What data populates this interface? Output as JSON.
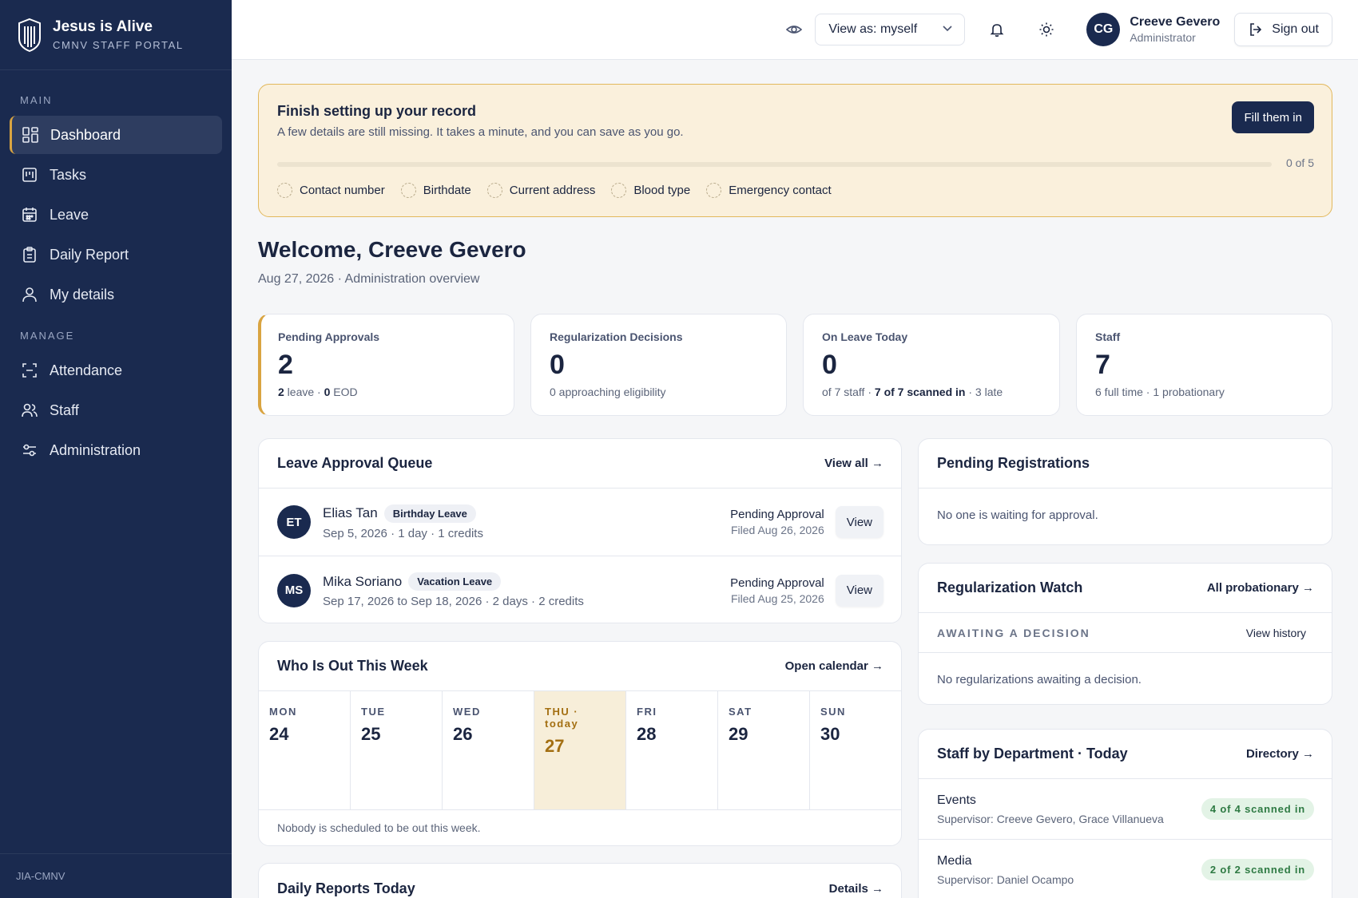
{
  "brand": {
    "title": "Jesus is Alive",
    "subtitle": "CMNV STAFF PORTAL"
  },
  "sidebar": {
    "main_label": "MAIN",
    "manage_label": "MANAGE",
    "main_items": [
      {
        "label": "Dashboard",
        "icon": "dashboard-icon"
      },
      {
        "label": "Tasks",
        "icon": "tasks-icon"
      },
      {
        "label": "Leave",
        "icon": "calendar-icon"
      },
      {
        "label": "Daily Report",
        "icon": "clipboard-icon"
      },
      {
        "label": "My details",
        "icon": "user-icon"
      }
    ],
    "manage_items": [
      {
        "label": "Attendance",
        "icon": "scan-icon"
      },
      {
        "label": "Staff",
        "icon": "users-icon"
      },
      {
        "label": "Administration",
        "icon": "sliders-icon"
      }
    ],
    "footer": "JIA-CMNV"
  },
  "header": {
    "view_as": "View as: myself",
    "user_initials": "CG",
    "user_name": "Creeve Gevero",
    "user_role": "Administrator",
    "sign_out": "Sign out"
  },
  "setup": {
    "title": "Finish setting up your record",
    "description": "A few details are still missing. It takes a minute, and you can save as you go.",
    "button": "Fill them in",
    "progress_text": "0 of 5",
    "progress_fraction": 0,
    "items": [
      "Contact number",
      "Birthdate",
      "Current address",
      "Blood type",
      "Emergency contact"
    ]
  },
  "welcome": {
    "title": "Welcome, Creeve Gevero",
    "subtitle": "Aug 27, 2026 · Administration overview"
  },
  "stats": {
    "pending": {
      "label": "Pending Approvals",
      "value": "2",
      "n1": "2",
      "t1": " leave · ",
      "n2": "0",
      "t2": " EOD"
    },
    "regularization": {
      "label": "Regularization Decisions",
      "value": "0",
      "sub": "0 approaching eligibility"
    },
    "on_leave": {
      "label": "On Leave Today",
      "value": "0",
      "t1": "of 7 staff · ",
      "bold": "7 of 7 scanned in",
      "t2": " · 3 late"
    },
    "staff": {
      "label": "Staff",
      "value": "7",
      "sub": "6 full time · 1 probationary"
    }
  },
  "leave_queue": {
    "title": "Leave Approval Queue",
    "link": "View all →",
    "rows": [
      {
        "initials": "ET",
        "name": "Elias Tan",
        "type": "Birthday Leave",
        "detail": "Sep 5, 2026 · 1 day · 1 credits",
        "status": "Pending Approval",
        "filed": "Filed Aug 26, 2026",
        "action": "View"
      },
      {
        "initials": "MS",
        "name": "Mika Soriano",
        "type": "Vacation Leave",
        "detail": "Sep 17, 2026 to Sep 18, 2026 · 2 days · 2 credits",
        "status": "Pending Approval",
        "filed": "Filed Aug 25, 2026",
        "action": "View"
      }
    ]
  },
  "week": {
    "title": "Who Is Out This Week",
    "link": "Open calendar →",
    "days": [
      {
        "name": "MON",
        "num": "24"
      },
      {
        "name": "TUE",
        "num": "25"
      },
      {
        "name": "WED",
        "num": "26"
      },
      {
        "name": "THU · today",
        "num": "27"
      },
      {
        "name": "FRI",
        "num": "28"
      },
      {
        "name": "SAT",
        "num": "29"
      },
      {
        "name": "SUN",
        "num": "30"
      }
    ],
    "note": "Nobody is scheduled to be out this week."
  },
  "daily_reports": {
    "title": "Daily Reports Today",
    "link": "Details →"
  },
  "pending_registrations": {
    "title": "Pending Registrations",
    "empty": "No one is waiting for approval."
  },
  "regularization_watch": {
    "title": "Regularization Watch",
    "link": "All probationary →",
    "sub_label": "AWAITING A DECISION",
    "sub_link": "View history",
    "empty": "No regularizations awaiting a decision."
  },
  "departments": {
    "title": "Staff by Department · Today",
    "link": "Directory →",
    "rows": [
      {
        "name": "Events",
        "supervisor": "Supervisor: Creeve Gevero, Grace Villanueva",
        "badge": "4 of 4 scanned in"
      },
      {
        "name": "Media",
        "supervisor": "Supervisor: Daniel Ocampo",
        "badge": "2 of 2 scanned in"
      }
    ]
  },
  "colors": {
    "sidebar": "#1a2a4f",
    "accent": "#d9a441",
    "success": "#2e7a43"
  }
}
